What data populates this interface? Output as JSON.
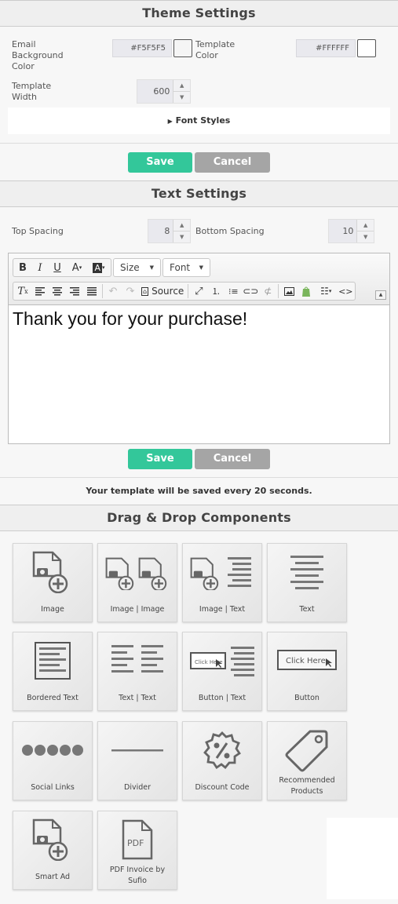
{
  "theme": {
    "title": "Theme Settings",
    "email_bg_label": "Email Background Color",
    "email_bg_value": "#F5F5F5",
    "template_color_label": "Template Color",
    "template_color_value": "#FFFFFF",
    "template_width_label": "Template Width",
    "template_width_value": "600",
    "font_styles_label": "Font Styles",
    "save": "Save",
    "cancel": "Cancel"
  },
  "text": {
    "title": "Text Settings",
    "top_spacing_label": "Top Spacing",
    "top_spacing_value": "8",
    "bottom_spacing_label": "Bottom Spacing",
    "bottom_spacing_value": "10",
    "toolbar": {
      "size_label": "Size",
      "font_label": "Font",
      "source_label": "Source"
    },
    "content": "Thank you for your purchase!",
    "save": "Save",
    "cancel": "Cancel",
    "autosave_note": "Your template will be saved every 20 seconds."
  },
  "components": {
    "title": "Drag & Drop Components",
    "items": [
      {
        "label": "Image",
        "icon": "image-add-icon"
      },
      {
        "label": "Image | Image",
        "icon": "image-image-icon"
      },
      {
        "label": "Image | Text",
        "icon": "image-text-icon"
      },
      {
        "label": "Text",
        "icon": "text-lines-icon"
      },
      {
        "label": "Bordered Text",
        "icon": "bordered-text-icon"
      },
      {
        "label": "Text | Text",
        "icon": "text-text-icon"
      },
      {
        "label": "Button | Text",
        "icon": "button-text-icon"
      },
      {
        "label": "Button",
        "icon": "button-icon"
      },
      {
        "label": "Social Links",
        "icon": "social-dots-icon"
      },
      {
        "label": "Divider",
        "icon": "divider-icon"
      },
      {
        "label": "Discount Code",
        "icon": "percent-badge-icon"
      },
      {
        "label": "Recommended Products",
        "icon": "tag-icon"
      },
      {
        "label": "Smart Ad",
        "icon": "image-add-icon"
      },
      {
        "label": "PDF Invoice by Sufio",
        "icon": "pdf-file-icon"
      }
    ],
    "button_icon_text_small": "Click Here",
    "button_icon_text": "Click Here",
    "pdf_icon_text": "PDF"
  }
}
